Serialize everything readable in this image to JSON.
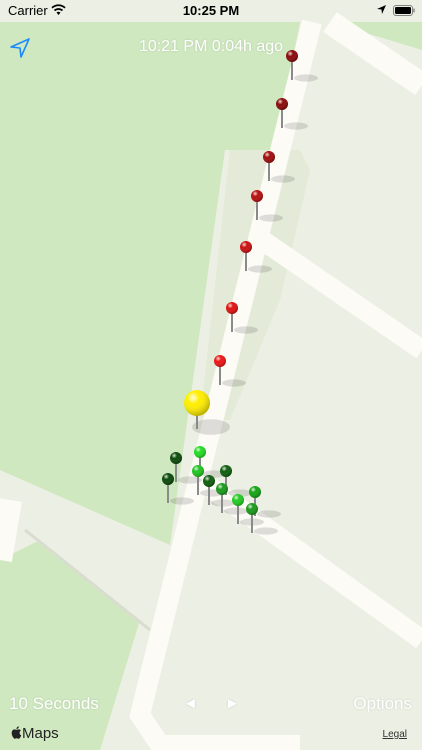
{
  "status_bar": {
    "carrier": "Carrier",
    "time": "10:25 PM"
  },
  "header": {
    "title": "10:21 PM 0:04h ago"
  },
  "controls": {
    "interval_label": "10 Seconds",
    "prev_symbol": "◄",
    "next_symbol": "►",
    "options_label": "Options"
  },
  "footer": {
    "maps_label": "Maps",
    "legal_label": "Legal"
  },
  "colors": {
    "park_green": "#cfe8c0",
    "land": "#ecefe3",
    "road": "#fdfbf6",
    "accent_blue": "#1a8cff",
    "pin_red_dark": "#8b0a0a",
    "pin_red": "#e01010",
    "pin_yellow": "#ffee00",
    "pin_green_light": "#22dd22",
    "pin_green": "#13a413",
    "pin_green_dark": "#0a4a0a"
  },
  "icons": {
    "wifi": "wifi-icon",
    "location_status": "location-arrow-icon",
    "battery": "battery-icon",
    "locate": "location-arrow-button-icon",
    "apple": "apple-logo-icon"
  },
  "pins": [
    {
      "name": "pin-1",
      "color": "#8b0a0a"
    },
    {
      "name": "pin-2",
      "color": "#8b0a0a"
    },
    {
      "name": "pin-3",
      "color": "#a00c0c"
    },
    {
      "name": "pin-4",
      "color": "#b80e0e"
    },
    {
      "name": "pin-5",
      "color": "#cc1010"
    },
    {
      "name": "pin-6",
      "color": "#e01010"
    },
    {
      "name": "pin-7",
      "color": "#ee1414"
    },
    {
      "name": "pin-current",
      "color": "#ffee00"
    },
    {
      "name": "pin-9",
      "color": "#22dd22"
    },
    {
      "name": "pin-10",
      "color": "#0a4a0a"
    },
    {
      "name": "pin-11",
      "color": "#0a4a0a"
    },
    {
      "name": "pin-12",
      "color": "#0d5e0d"
    },
    {
      "name": "pin-13",
      "color": "#1fc41f"
    },
    {
      "name": "pin-14",
      "color": "#0d5e0d"
    },
    {
      "name": "pin-15",
      "color": "#1a9a1a"
    },
    {
      "name": "pin-16",
      "color": "#13a413"
    },
    {
      "name": "pin-17",
      "color": "#22cc22"
    },
    {
      "name": "pin-18",
      "color": "#1a9a1a"
    }
  ]
}
